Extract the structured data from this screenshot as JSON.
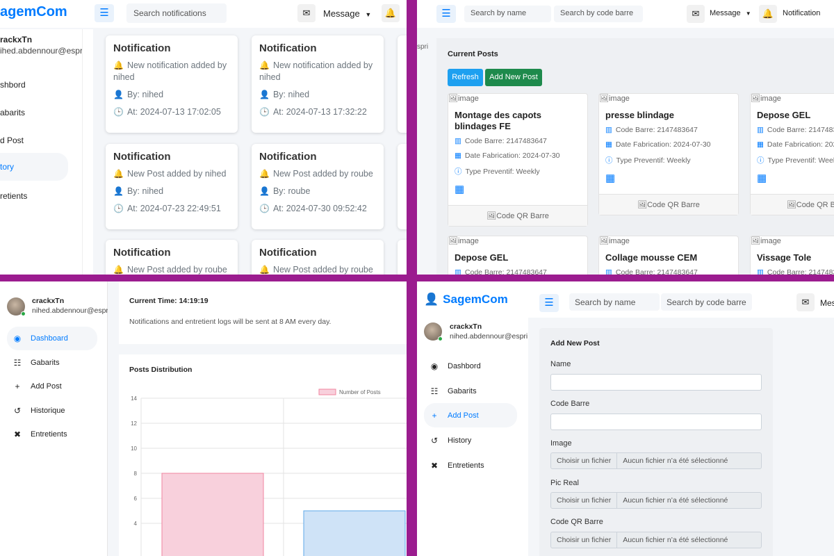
{
  "q1": {
    "brand": "agemCom",
    "search_placeholder": "Search notifications",
    "message_label": "Message",
    "user_name": "rackxTn",
    "user_email": "ihed.abdennour@espri",
    "nav": [
      "shbord",
      "abarits",
      "d Post",
      "tory",
      "retients"
    ],
    "cards": [
      {
        "title": "Notification",
        "line": "New notification added by nihed",
        "by": "By: nihed",
        "at": "At: 2024-07-13 17:02:05"
      },
      {
        "title": "Notification",
        "line": "New notification added by nihed",
        "by": "By: nihed",
        "at": "At: 2024-07-13 17:32:22"
      },
      {
        "title": "Notification",
        "line": "New Post added by nihed",
        "by": "By: nihed",
        "at": "At: 2024-07-23 22:49:51"
      },
      {
        "title": "Notification",
        "line": "New Post added by roube",
        "by": "By: roube",
        "at": "At: 2024-07-30 09:52:42"
      },
      {
        "title": "Notification",
        "line": "New Post added by roube",
        "by": "",
        "at": ""
      },
      {
        "title": "Notification",
        "line": "New Post added by roube",
        "by": "",
        "at": ""
      }
    ]
  },
  "q2": {
    "search_name": "Search by name",
    "search_code": "Search by code barre",
    "message_label": "Message",
    "notification_label": "Notification",
    "edge_text": "spri",
    "section_title": "Current Posts",
    "refresh_button": "Refresh",
    "add_button": "Add New Post",
    "posts": [
      {
        "img": "image",
        "title": "Montage des capots blindages FE",
        "code": "Code Barre: 2147483647",
        "date": "Date Fabrication: 2024-07-30",
        "type": "Type Preventif: Weekly",
        "foot": "Code QR Barre"
      },
      {
        "img": "image",
        "title": "presse blindage",
        "code": "Code Barre: 2147483647",
        "date": "Date Fabrication: 2024-07-30",
        "type": "Type Preventif: Weekly",
        "foot": "Code QR Barre"
      },
      {
        "img": "image",
        "title": "Depose GEL",
        "code": "Code Barre: 2147483",
        "date": "Date Fabrication: 202",
        "type": "Type Preventif: Week",
        "foot": "Code QR B"
      },
      {
        "img": "image",
        "title": "Depose GEL",
        "code": "Code Barre: 2147483647"
      },
      {
        "img": "image",
        "title": "Collage mousse CEM",
        "code": "Code Barre: 2147483647"
      },
      {
        "img": "image",
        "title": "Vissage Tole",
        "code": "Code Barre: 2147483"
      }
    ]
  },
  "q3": {
    "user_name": "crackxTn",
    "user_email": "nihed.abdennour@espri",
    "nav": [
      "Dashboard",
      "Gabarits",
      "Add Post",
      "Historique",
      "Entretients"
    ],
    "current_time": "Current Time: 14:19:19",
    "notice": "Notifications and entretient logs will be sent at 8 AM every day.",
    "chart_title": "Posts Distribution"
  },
  "q4": {
    "brand": "SagemCom",
    "search_name": "Search by name",
    "search_code": "Search by code barre",
    "message_label": "Mes",
    "user_name": "crackxTn",
    "user_email": "nihed.abdennour@espri",
    "nav": [
      "Dashbord",
      "Gabarits",
      "Add Post",
      "History",
      "Entretients"
    ],
    "form_title": "Add New Post",
    "fields": {
      "name": "Name",
      "code": "Code Barre",
      "image": "Image",
      "pic": "Pic Real",
      "qr": "Code QR Barre"
    },
    "file_button": "Choisir un fichier",
    "file_none": "Aucun fichier n’a été sélectionné"
  },
  "chart_data": {
    "type": "bar",
    "title": "Posts Distribution",
    "legend": "Number of Posts",
    "legend_position": "top",
    "grid": true,
    "ylim": [
      0,
      14
    ],
    "yticks": [
      4,
      6,
      8,
      10,
      12,
      14
    ],
    "series": [
      {
        "name": "Number of Posts",
        "values": [
          8,
          5
        ]
      }
    ],
    "colors": [
      "#f8d0dc",
      "#cfe3f7"
    ],
    "border_colors": [
      "#f0849f",
      "#5fa8e8"
    ]
  }
}
